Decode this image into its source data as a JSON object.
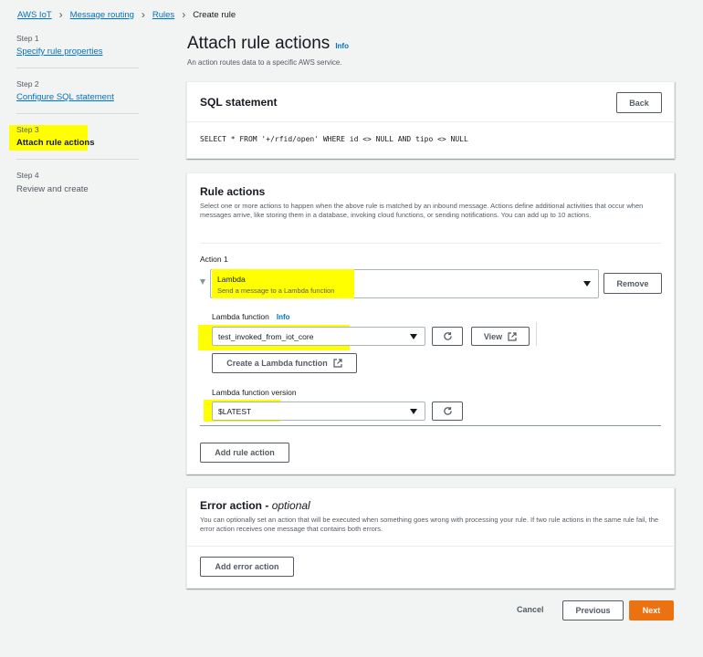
{
  "breadcrumb": {
    "items": [
      "AWS IoT",
      "Message routing",
      "Rules"
    ],
    "current": "Create rule"
  },
  "steps": [
    {
      "label": "Step 1",
      "name": "Specify rule properties"
    },
    {
      "label": "Step 2",
      "name": "Configure SQL statement"
    },
    {
      "label": "Step 3",
      "name": "Attach rule actions"
    },
    {
      "label": "Step 4",
      "name": "Review and create"
    }
  ],
  "header": {
    "title": "Attach rule actions",
    "info": "Info",
    "subtitle": "An action routes data to a specific AWS service."
  },
  "sql": {
    "title": "SQL statement",
    "back": "Back",
    "statement": "SELECT * FROM '+/rfid/open' WHERE id <> NULL AND tipo <> NULL"
  },
  "rule_actions": {
    "title": "Rule actions",
    "description": "Select one or more actions to happen when the above rule is matched by an inbound message. Actions define additional activities that occur when messages arrive, like storing them in a database, invoking cloud functions, or sending notifications. You can add up to 10 actions.",
    "action_label": "Action 1",
    "action_value": "Lambda",
    "action_desc": "Send a message to a Lambda function",
    "remove": "Remove",
    "lambda_label": "Lambda function",
    "lambda_info": "Info",
    "lambda_value": "test_invoked_from_iot_core",
    "view": "View",
    "create": "Create a Lambda function",
    "version_label": "Lambda function version",
    "version_value": "$LATEST",
    "add": "Add rule action"
  },
  "error_action": {
    "title": "Error action",
    "optional": "optional",
    "dash": " - ",
    "description": "You can optionally set an action that will be executed when something goes wrong with processing your rule. If two rule actions in the same rule fail, the error action receives one message that contains both errors.",
    "add": "Add error action"
  },
  "footer": {
    "cancel": "Cancel",
    "previous": "Previous",
    "next": "Next"
  },
  "colors": {
    "highlight": "#ffff00",
    "primary": "#ec7211",
    "link": "#0073bb"
  }
}
